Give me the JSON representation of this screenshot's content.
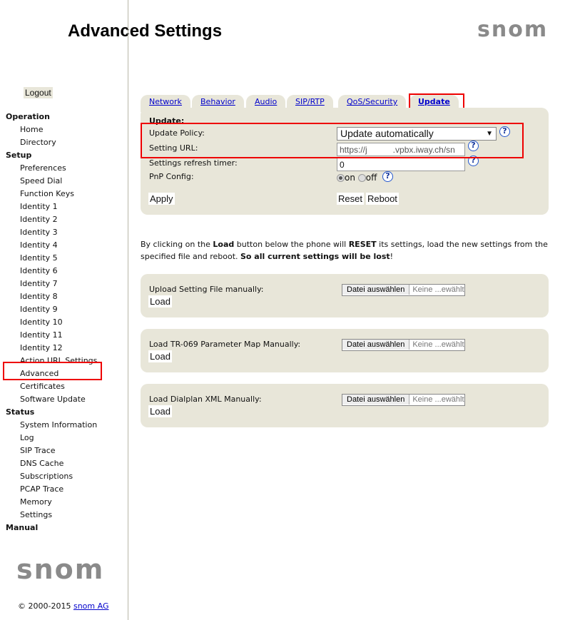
{
  "header": {
    "title": "Advanced Settings",
    "logo": "snom"
  },
  "sidebar": {
    "logout": "Logout",
    "sections": [
      {
        "heading": "Operation",
        "items": [
          "Home",
          "Directory"
        ]
      },
      {
        "heading": "Setup",
        "items": [
          "Preferences",
          "Speed Dial",
          "Function Keys",
          "Identity 1",
          "Identity 2",
          "Identity 3",
          "Identity 4",
          "Identity 5",
          "Identity 6",
          "Identity 7",
          "Identity 8",
          "Identity 9",
          "Identity 10",
          "Identity 11",
          "Identity 12",
          "Action URL Settings",
          "Advanced",
          "Certificates",
          "Software Update"
        ]
      },
      {
        "heading": "Status",
        "items": [
          "System Information",
          "Log",
          "SIP Trace",
          "DNS Cache",
          "Subscriptions",
          "PCAP Trace",
          "Memory",
          "Settings"
        ]
      },
      {
        "heading": "Manual",
        "items": []
      }
    ],
    "active": "Advanced",
    "logo": "snom",
    "copyright": "© 2000-2015",
    "copyright_link": "snom AG"
  },
  "tabs": [
    "Network",
    "Behavior",
    "Audio",
    "SIP/RTP",
    "QoS/Security",
    "Update"
  ],
  "active_tab": "Update",
  "update": {
    "heading": "Update:",
    "policy_label": "Update Policy:",
    "policy_value": "Update automatically",
    "url_label": "Setting URL:",
    "url_value": "https://j   .vpbx.iway.ch/sn",
    "timer_label": "Settings refresh timer:",
    "timer_value": "0",
    "pnp_label": "PnP Config:",
    "pnp_on": "on",
    "pnp_off": "off",
    "pnp_selected": "on",
    "apply": "Apply",
    "reset": "Reset",
    "reboot": "Reboot",
    "help": "?"
  },
  "warning": {
    "p1": "By clicking on the ",
    "b1": "Load",
    "p2": " button below the phone will ",
    "b2": "RESET",
    "p3": " its settings, load the new settings from the specified file and reboot. ",
    "b3": "So all current settings will be lost",
    "p4": "!"
  },
  "uploads": [
    {
      "label": "Upload Setting File manually:",
      "choose": "Datei auswählen",
      "none": "Keine ...ewählt",
      "load": "Load"
    },
    {
      "label": "Load TR-069 Parameter Map Manually:",
      "choose": "Datei auswählen",
      "none": "Keine ...ewählt",
      "load": "Load"
    },
    {
      "label": "Load Dialplan XML Manually:",
      "choose": "Datei auswählen",
      "none": "Keine ...ewählt",
      "load": "Load"
    }
  ],
  "colors": {
    "panel": "#e8e6d9",
    "link": "#0000cc",
    "highlight": "#ee0000"
  }
}
